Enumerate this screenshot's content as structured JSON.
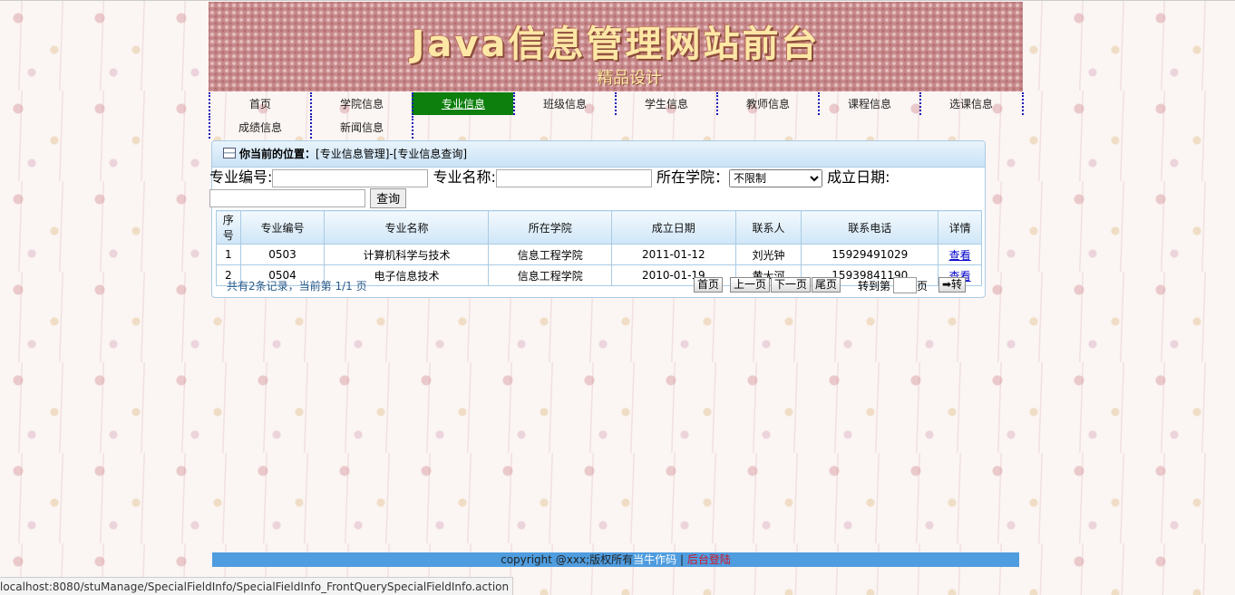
{
  "banner": {
    "title": "Java信息管理网站前台",
    "subtitle": "精品设计"
  },
  "nav": {
    "items": [
      {
        "label": "首页"
      },
      {
        "label": "学院信息"
      },
      {
        "label": "专业信息"
      },
      {
        "label": "班级信息"
      },
      {
        "label": "学生信息"
      },
      {
        "label": "教师信息"
      },
      {
        "label": "课程信息"
      },
      {
        "label": "选课信息"
      },
      {
        "label": "成绩信息"
      },
      {
        "label": "新闻信息"
      }
    ],
    "active": "专业信息"
  },
  "breadcrumb": {
    "label": "你当前的位置：",
    "path": "[专业信息管理]-[专业信息查询]"
  },
  "search": {
    "code_label": "专业编号:",
    "code_value": "",
    "name_label": "专业名称:",
    "name_value": "",
    "college_label": "所在学院：",
    "college_selected": "不限制",
    "date_label": "成立日期:",
    "date_value": "",
    "query_button": "查询"
  },
  "table": {
    "headers": [
      "序号",
      "专业编号",
      "专业名称",
      "所在学院",
      "成立日期",
      "联系人",
      "联系电话",
      "详情"
    ],
    "rows": [
      {
        "idx": "1",
        "code": "0503",
        "name": "计算机科学与技术",
        "college": "信息工程学院",
        "date": "2011-01-12",
        "contact": "刘光钟",
        "phone": "15929491029",
        "detail": "查看"
      },
      {
        "idx": "2",
        "code": "0504",
        "name": "电子信息技术",
        "college": "信息工程学院",
        "date": "2010-01-19",
        "contact": "黄大河",
        "phone": "15939841190",
        "detail": "查看"
      }
    ]
  },
  "pager": {
    "info": "共有2条记录，当前第 1/1 页",
    "first": "首页",
    "prev": "上一页",
    "next": "下一页",
    "last": "尾页",
    "goto_label": "转到第",
    "page_unit": "页",
    "go_button": "➡转"
  },
  "footer": {
    "text": "copyright @xxx;版权所有",
    "author": "当牛作码",
    "sep": "|",
    "admin": "后台登陆"
  },
  "statusbar": {
    "url": "localhost:8080/stuManage/SpecialFieldInfo/SpecialFieldInfo_FrontQuerySpecialFieldInfo.action"
  }
}
